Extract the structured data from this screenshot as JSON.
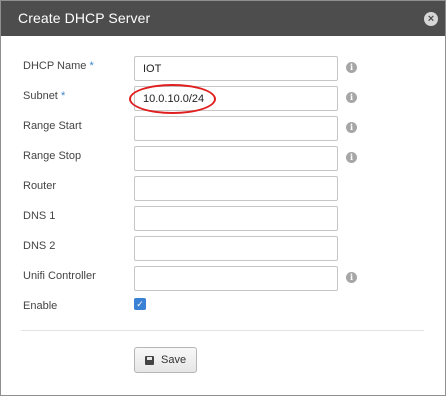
{
  "dialog": {
    "title": "Create DHCP Server",
    "close_icon": "×"
  },
  "form": {
    "fields": [
      {
        "label": "DHCP Name",
        "required": "*",
        "value": "IOT",
        "placeholder": ""
      },
      {
        "label": "Subnet",
        "required": "*",
        "value": "10.0.10.0/24",
        "placeholder": ""
      },
      {
        "label": "Range Start",
        "required": "",
        "value": "",
        "placeholder": ""
      },
      {
        "label": "Range Stop",
        "required": "",
        "value": "",
        "placeholder": ""
      },
      {
        "label": "Router",
        "required": "",
        "value": "",
        "placeholder": ""
      },
      {
        "label": "DNS 1",
        "required": "",
        "value": "",
        "placeholder": ""
      },
      {
        "label": "DNS 2",
        "required": "",
        "value": "",
        "placeholder": ""
      },
      {
        "label": "Unifi Controller",
        "required": "",
        "value": "",
        "placeholder": ""
      }
    ],
    "enable_label": "Enable",
    "enable_checked": true,
    "info_icon": "i",
    "check_icon": "✓"
  },
  "footer": {
    "save_label": "Save",
    "save_icon": "floppy-disk-icon"
  },
  "colors": {
    "titlebar": "#4d4d4d",
    "accent": "#3b82d6",
    "required": "#3a86c8",
    "annotation": "#e02020"
  }
}
